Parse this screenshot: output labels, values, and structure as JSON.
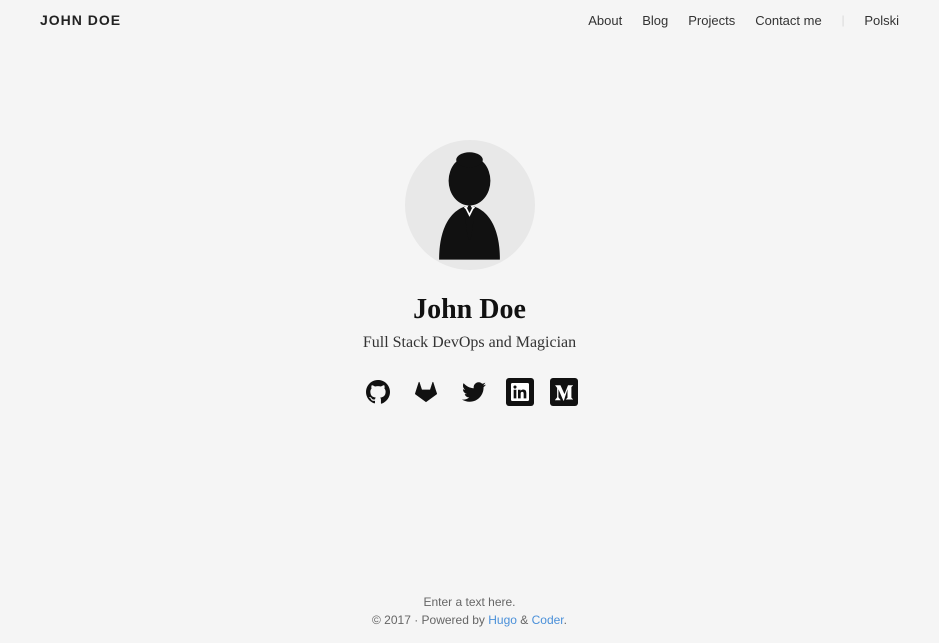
{
  "site": {
    "title": "JOHN DOE"
  },
  "nav": {
    "about_label": "About",
    "blog_label": "Blog",
    "projects_label": "Projects",
    "contact_label": "Contact me",
    "divider": "|",
    "lang_label": "Polski"
  },
  "hero": {
    "name": "John Doe",
    "subtitle": "Full Stack DevOps and Magician"
  },
  "social": {
    "github_title": "GitHub",
    "gitlab_title": "GitLab",
    "twitter_title": "Twitter",
    "linkedin_title": "LinkedIn",
    "medium_title": "Medium"
  },
  "footer": {
    "placeholder_text": "Enter a text here.",
    "credit_text": "© 2017 · Powered by ",
    "hugo_label": "Hugo",
    "amp_label": " & ",
    "coder_label": "Coder",
    "period": "."
  }
}
